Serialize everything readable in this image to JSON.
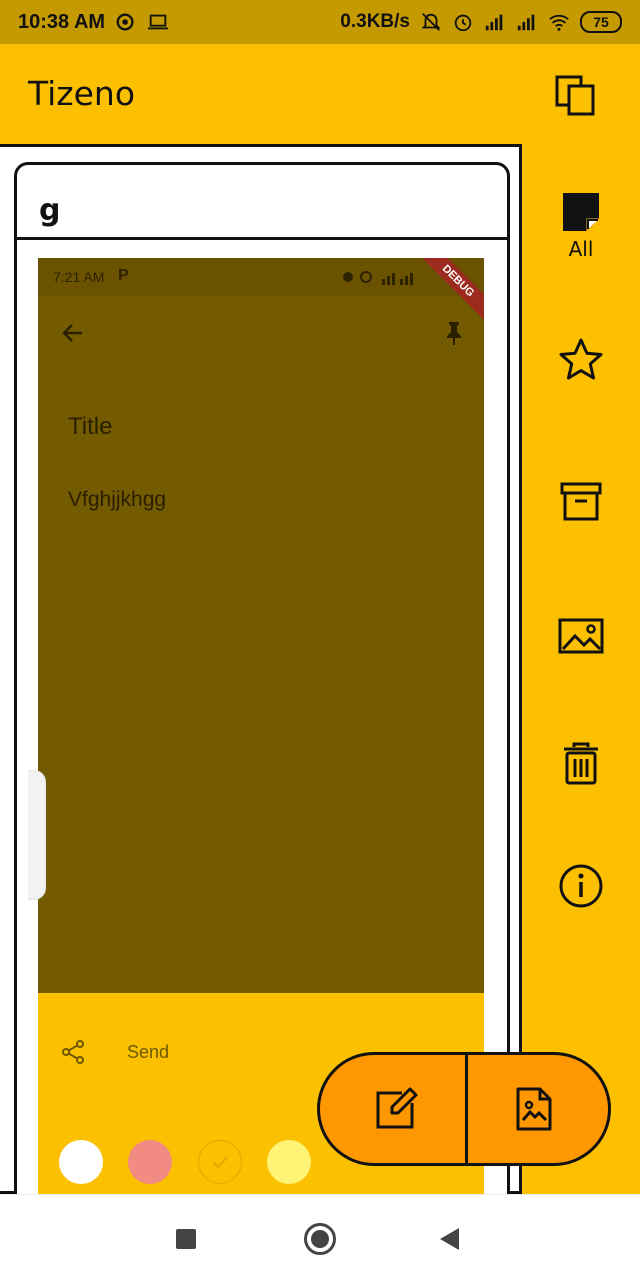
{
  "status_bar": {
    "time": "10:38 AM",
    "network_speed": "0.3KB/s",
    "battery": "75",
    "icons": [
      "chat-icon",
      "laptop-icon",
      "mute-icon",
      "alarm-icon",
      "signal-icon",
      "signal-icon",
      "wifi-icon",
      "battery-icon"
    ]
  },
  "app_bar": {
    "title": "Tizeno",
    "action_icon": "copy-icon"
  },
  "rail": {
    "items": [
      {
        "icon": "note-icon",
        "label": "All",
        "selected": true
      },
      {
        "icon": "star-icon",
        "label": ""
      },
      {
        "icon": "archive-icon",
        "label": ""
      },
      {
        "icon": "image-icon",
        "label": ""
      },
      {
        "icon": "trash-icon",
        "label": ""
      },
      {
        "icon": "info-icon",
        "label": ""
      }
    ]
  },
  "note_card": {
    "title": "g",
    "preview": {
      "status_time": "7:21 AM",
      "status_app": "P",
      "debug_banner": "DEBUG",
      "note_title": "Title",
      "note_body": "Vfghjjkhgg",
      "send_label": "Send",
      "colors": [
        "#ffffff",
        "#f28b82",
        "#fbc000",
        "#fff475"
      ]
    }
  },
  "fab": {
    "buttons": [
      {
        "icon": "edit-note-icon"
      },
      {
        "icon": "image-note-icon"
      }
    ]
  },
  "colors": {
    "accent": "#fdc000",
    "fab": "#ff9800",
    "status_bar": "#c49a00",
    "preview_overlay": "#745a00"
  }
}
